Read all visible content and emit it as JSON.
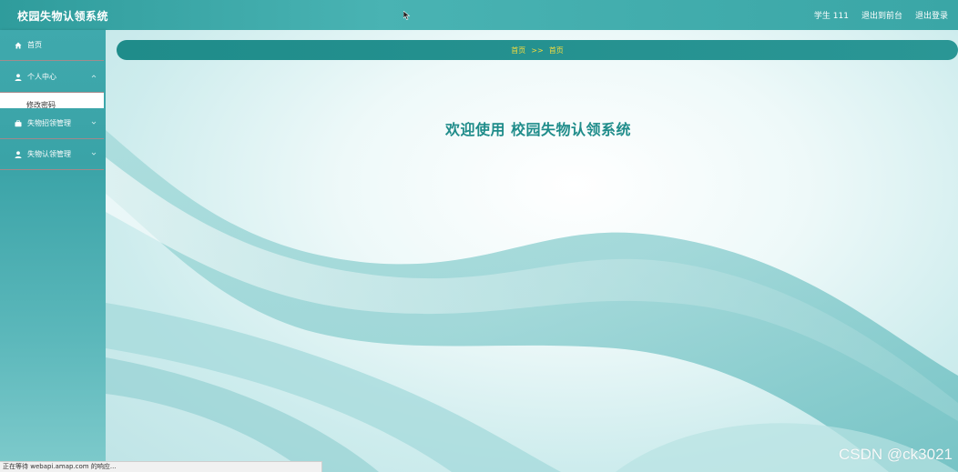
{
  "header": {
    "app_title": "校园失物认领系统",
    "user_label": "学生 111",
    "to_frontend": "退出到前台",
    "logout": "退出登录"
  },
  "sidebar": {
    "items": [
      {
        "label": "首页",
        "icon": "home-icon"
      },
      {
        "label": "个人中心",
        "icon": "user-icon",
        "expanded": true,
        "children": [
          {
            "label": "修改密码"
          }
        ]
      },
      {
        "label": "失物招领管理",
        "icon": "briefcase-icon"
      },
      {
        "label": "失物认领管理",
        "icon": "user-icon"
      }
    ]
  },
  "breadcrumb": {
    "first": "首页",
    "separator": ">>",
    "second": "首页"
  },
  "main": {
    "welcome": "欢迎使用 校园失物认领系统"
  },
  "statusbar": {
    "text": "正在等待 webapi.amap.com 的响应..."
  },
  "watermark": {
    "text": "CSDN @ck3021"
  },
  "colors": {
    "accent": "#1f8c8a",
    "header": "#3aa6a6",
    "breadcrumb_text": "#f5dc3c"
  }
}
